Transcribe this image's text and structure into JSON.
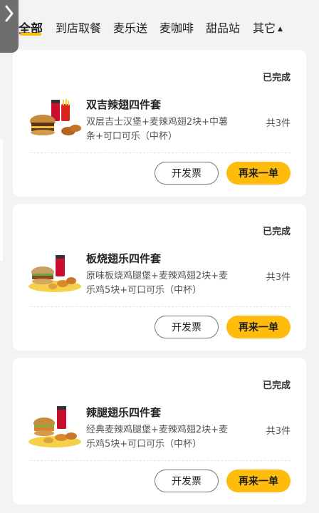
{
  "tabs": [
    {
      "label": "全部",
      "active": true
    },
    {
      "label": "到店取餐"
    },
    {
      "label": "麦乐送"
    },
    {
      "label": "麦咖啡"
    },
    {
      "label": "甜品站"
    },
    {
      "label": "其它"
    }
  ],
  "tabs_dropdown_icon": "caret-up-icon",
  "back_icon": "chevron-right-icon",
  "accent_color": "#ffbc0d",
  "orders": [
    {
      "status": "已完成",
      "name": "双吉辣翅四件套",
      "desc": "双层吉士汉堡+麦辣鸡翅2块+中薯条+可口可乐（中杯）",
      "count": "共3件",
      "invoice_label": "开发票",
      "reorder_label": "再来一单"
    },
    {
      "status": "已完成",
      "name": "板烧翅乐四件套",
      "desc": "原味板烧鸡腿堡+麦辣鸡翅2块+麦乐鸡5块+可口可乐（中杯）",
      "count": "共3件",
      "invoice_label": "开发票",
      "reorder_label": "再来一单"
    },
    {
      "status": "已完成",
      "name": "辣腿翅乐四件套",
      "desc": "经典麦辣鸡腿堡+麦辣鸡翅2块+麦乐鸡5块+可口可乐（中杯）",
      "count": "共3件",
      "invoice_label": "开发票",
      "reorder_label": "再来一单"
    }
  ]
}
